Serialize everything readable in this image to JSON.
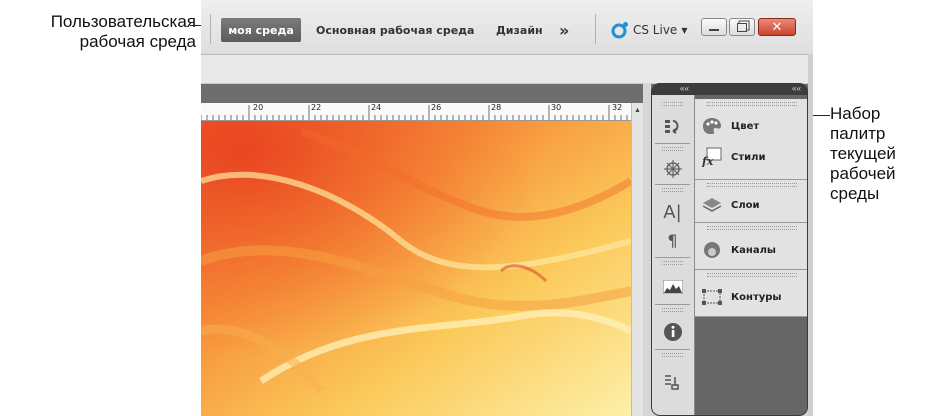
{
  "annotations": {
    "workspace_callout": [
      "Пользовательская",
      "рабочая среда"
    ],
    "panels_callout": [
      "Набор",
      "палитр",
      "текущей",
      "рабочей",
      "среды"
    ]
  },
  "menubar": {
    "active_workspace": "моя среда",
    "workspaces": [
      "Основная рабочая среда",
      "Дизайн"
    ],
    "more_glyph": "»",
    "cs_live": "CS Live"
  },
  "ruler": {
    "labels": [
      "20",
      "22",
      "24",
      "26",
      "28",
      "30",
      "32"
    ]
  },
  "panel": {
    "collapse_glyph": "««",
    "palettes": {
      "color": "Цвет",
      "styles": "Стили",
      "layers": "Слои",
      "channels": "Каналы",
      "paths": "Контуры"
    }
  },
  "colors": {
    "active_tab": "#6a6a6a",
    "close_button": "#d0523c",
    "panel_dark": "#525252",
    "cs_live_icon": "#1f8fd6"
  }
}
